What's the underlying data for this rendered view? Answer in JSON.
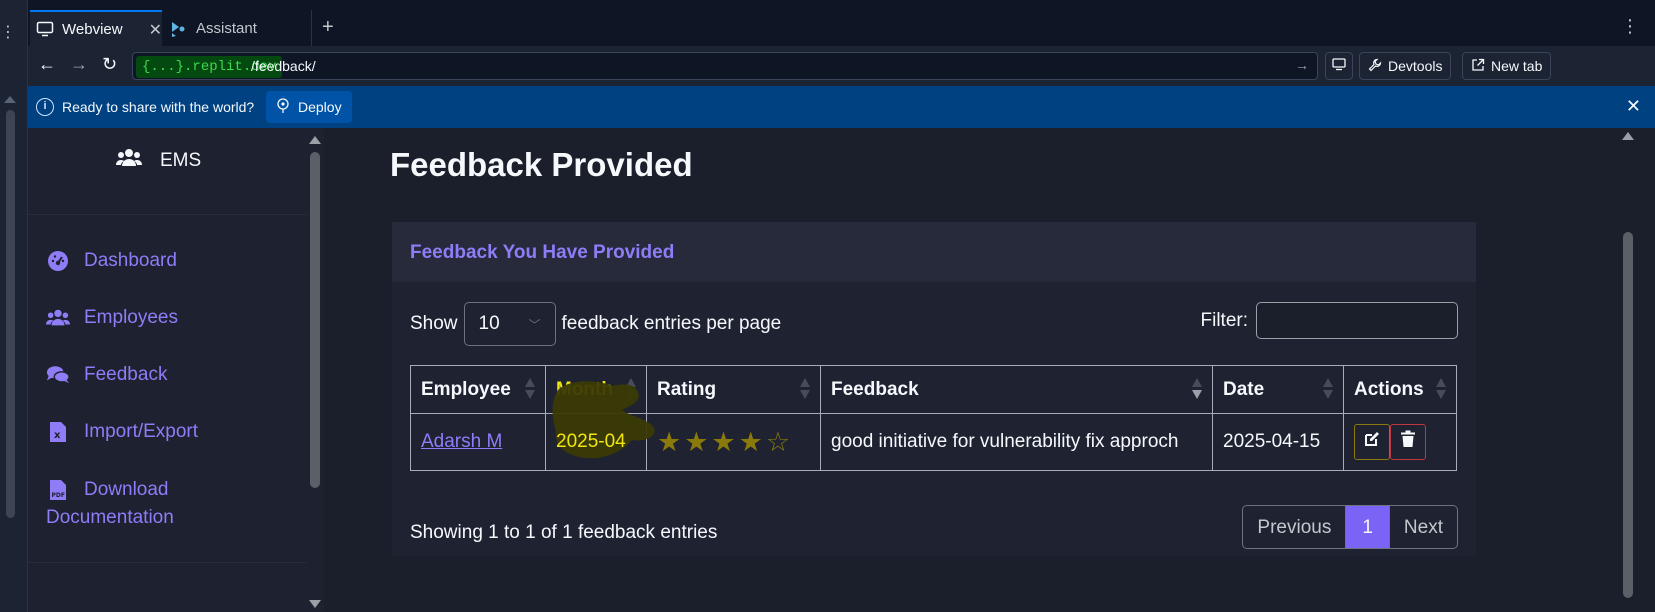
{
  "browser": {
    "tabs": [
      {
        "label": "Webview",
        "icon": "monitor-icon",
        "active": true
      },
      {
        "label": "Assistant",
        "icon": "assistant-icon",
        "active": false
      }
    ],
    "address": {
      "domain_prefix": "{...}",
      "domain_suffix": ".replit.dev",
      "path": "/feedback/"
    },
    "devtools_label": "Devtools",
    "new_tab_label": "New tab",
    "banner": {
      "message": "Ready to share with the world?",
      "deploy_label": "Deploy"
    }
  },
  "sidebar": {
    "brand": "EMS",
    "items": [
      {
        "label": "Dashboard",
        "icon": "gauge-icon"
      },
      {
        "label": "Employees",
        "icon": "users-icon"
      },
      {
        "label": "Feedback",
        "icon": "comments-icon"
      },
      {
        "label": "Import/Export",
        "icon": "excel-file-icon"
      },
      {
        "label_line1": "Download",
        "label_line2": "Documentation",
        "icon": "pdf-file-icon"
      }
    ]
  },
  "main": {
    "title": "Feedback Provided",
    "card_title": "Feedback You Have Provided",
    "length": {
      "show": "Show",
      "value": "10",
      "suffix": "feedback entries per page"
    },
    "filter_label": "Filter:",
    "columns": [
      "Employee",
      "Month",
      "Rating",
      "Feedback",
      "Date",
      "Actions"
    ],
    "rows": [
      {
        "employee": "Adarsh M",
        "month": "2025-04",
        "rating": 4,
        "rating_max": 5,
        "feedback": "good initiative for vulnerability fix approch",
        "date": "2025-04-15"
      }
    ],
    "info": "Showing 1 to 1 of 1 feedback entries",
    "pager": {
      "previous": "Previous",
      "current": "1",
      "next": "Next"
    }
  },
  "colors": {
    "accent": "#8f7cf7",
    "banner": "#004182",
    "highlight": "#f2e60f"
  }
}
